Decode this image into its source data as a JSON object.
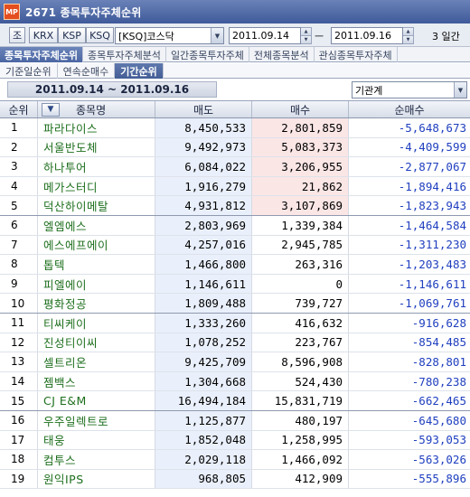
{
  "window": {
    "logo": "MP",
    "title": "2671 종목투자주체순위"
  },
  "toolbar": {
    "btn_jo": "조",
    "market_buttons": [
      "KRX",
      "KSP",
      "KSQ"
    ],
    "market_select": "[KSQ]코스닥",
    "date_from": "2011.09.14",
    "date_to": "2011.09.16",
    "separator": "ㅡ",
    "period": "3 일간"
  },
  "main_tabs": [
    {
      "label": "종목투자주체순위",
      "active": true
    },
    {
      "label": "종목투자주체분석",
      "active": false
    },
    {
      "label": "일간종목투자주체",
      "active": false
    },
    {
      "label": "전체종목분석",
      "active": false
    },
    {
      "label": "관심종목투자주체",
      "active": false
    }
  ],
  "sub_tabs": [
    {
      "label": "기준일순위",
      "active": false
    },
    {
      "label": "연속순매수",
      "active": false
    },
    {
      "label": "기간순위",
      "active": true
    }
  ],
  "range_label": "2011.09.14 ~ 2011.09.16",
  "investor_select": "기관계",
  "table": {
    "headers": {
      "rank": "순위",
      "name": "종목명",
      "sell": "매도",
      "buy": "매수",
      "net": "순매수"
    },
    "sort_icon": "triangle-down",
    "rows": [
      {
        "rank": "1",
        "name": "파라다이스",
        "sell": "8,450,533",
        "buy": "2,801,859",
        "net": "-5,648,673"
      },
      {
        "rank": "2",
        "name": "서울반도체",
        "sell": "9,492,973",
        "buy": "5,083,373",
        "net": "-4,409,599"
      },
      {
        "rank": "3",
        "name": "하나투어",
        "sell": "6,084,022",
        "buy": "3,206,955",
        "net": "-2,877,067"
      },
      {
        "rank": "4",
        "name": "메가스터디",
        "sell": "1,916,279",
        "buy": "21,862",
        "net": "-1,894,416"
      },
      {
        "rank": "5",
        "name": "덕산하이메탈",
        "sell": "4,931,812",
        "buy": "3,107,869",
        "net": "-1,823,943"
      },
      {
        "rank": "6",
        "name": "엘엠에스",
        "sell": "2,803,969",
        "buy": "1,339,384",
        "net": "-1,464,584"
      },
      {
        "rank": "7",
        "name": "에스에프에이",
        "sell": "4,257,016",
        "buy": "2,945,785",
        "net": "-1,311,230"
      },
      {
        "rank": "8",
        "name": "톱텍",
        "sell": "1,466,800",
        "buy": "263,316",
        "net": "-1,203,483"
      },
      {
        "rank": "9",
        "name": "피엘에이",
        "sell": "1,146,611",
        "buy": "0",
        "net": "-1,146,611"
      },
      {
        "rank": "10",
        "name": "평화정공",
        "sell": "1,809,488",
        "buy": "739,727",
        "net": "-1,069,761"
      },
      {
        "rank": "11",
        "name": "티씨케이",
        "sell": "1,333,260",
        "buy": "416,632",
        "net": "-916,628"
      },
      {
        "rank": "12",
        "name": "진성티이씨",
        "sell": "1,078,252",
        "buy": "223,767",
        "net": "-854,485"
      },
      {
        "rank": "13",
        "name": "셀트리온",
        "sell": "9,425,709",
        "buy": "8,596,908",
        "net": "-828,801"
      },
      {
        "rank": "14",
        "name": "젬백스",
        "sell": "1,304,668",
        "buy": "524,430",
        "net": "-780,238"
      },
      {
        "rank": "15",
        "name": "CJ E&M",
        "sell": "16,494,184",
        "buy": "15,831,719",
        "net": "-662,465"
      },
      {
        "rank": "16",
        "name": "우주일렉트로",
        "sell": "1,125,877",
        "buy": "480,197",
        "net": "-645,680"
      },
      {
        "rank": "17",
        "name": "태웅",
        "sell": "1,852,048",
        "buy": "1,258,995",
        "net": "-593,053"
      },
      {
        "rank": "18",
        "name": "컴투스",
        "sell": "2,029,118",
        "buy": "1,466,092",
        "net": "-563,026"
      },
      {
        "rank": "19",
        "name": "원익IPS",
        "sell": "968,805",
        "buy": "412,909",
        "net": "-555,896"
      }
    ],
    "highlight_buy_rows": 5,
    "group_separator_after": [
      5,
      10,
      15
    ]
  }
}
